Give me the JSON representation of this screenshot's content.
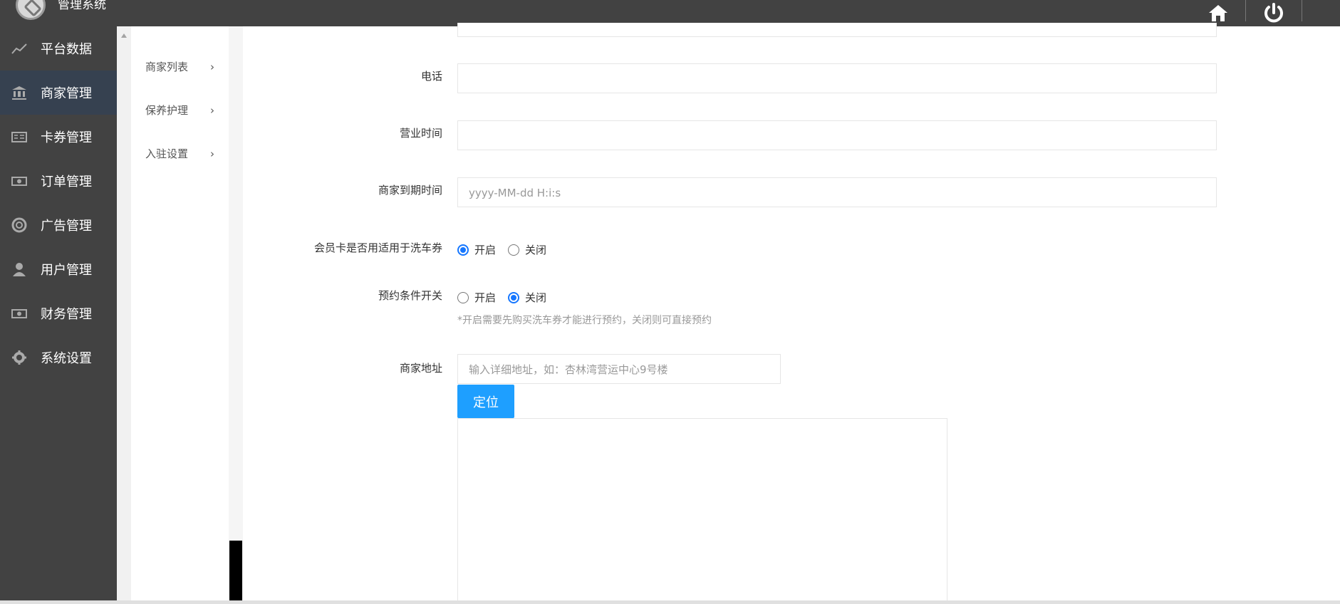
{
  "app": {
    "title": "管理系统"
  },
  "sidebar": {
    "items": [
      {
        "label": "平台数据",
        "icon": "line-chart-icon"
      },
      {
        "label": "商家管理",
        "icon": "bank-icon"
      },
      {
        "label": "卡券管理",
        "icon": "card-icon"
      },
      {
        "label": "订单管理",
        "icon": "money-icon"
      },
      {
        "label": "广告管理",
        "icon": "lifebuoy-icon"
      },
      {
        "label": "用户管理",
        "icon": "user-icon"
      },
      {
        "label": "财务管理",
        "icon": "money-icon"
      },
      {
        "label": "系统设置",
        "icon": "gear-icon"
      }
    ]
  },
  "subnav": {
    "items": [
      {
        "label": "商家列表"
      },
      {
        "label": "保养护理"
      },
      {
        "label": "入驻设置"
      }
    ]
  },
  "form": {
    "phone_label": "电话",
    "business_hours_label": "营业时间",
    "expire_label": "商家到期时间",
    "expire_placeholder": "yyyy-MM-dd H:i:s",
    "membership_label": "会员卡是否用适用于洗车券",
    "membership_on": "开启",
    "membership_off": "关闭",
    "booking_label": "预约条件开关",
    "booking_on": "开启",
    "booking_off": "关闭",
    "booking_help": "*开启需要先购买洗车券才能进行预约，关闭则可直接预约",
    "address_label": "商家地址",
    "address_placeholder": "输入详细地址，如：杏林湾营运中心9号楼",
    "locate_button": "定位"
  },
  "status": {
    "membership_selected": "开启",
    "booking_selected": "关闭"
  }
}
